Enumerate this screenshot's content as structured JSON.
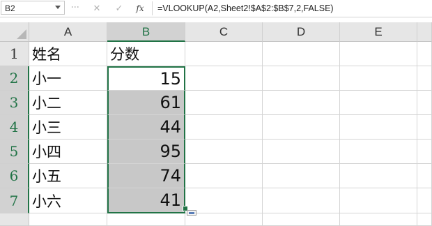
{
  "formula_bar": {
    "name_box": "B2",
    "cancel_icon": "✕",
    "enter_icon": "✓",
    "fx_label": "fx",
    "formula": "=VLOOKUP(A2,Sheet2!$A$2:$B$7,2,FALSE)"
  },
  "columns": [
    "A",
    "B",
    "C",
    "D",
    "E"
  ],
  "selected_column": "B",
  "rows": [
    {
      "num": "1",
      "a": "姓名",
      "b": "分数"
    },
    {
      "num": "2",
      "a": "小一",
      "b": "15"
    },
    {
      "num": "3",
      "a": "小二",
      "b": "61"
    },
    {
      "num": "4",
      "a": "小三",
      "b": "44"
    },
    {
      "num": "5",
      "a": "小四",
      "b": "95"
    },
    {
      "num": "6",
      "a": "小五",
      "b": "74"
    },
    {
      "num": "7",
      "a": "小六",
      "b": "41"
    }
  ],
  "selection_range": "B2:B7",
  "colors": {
    "selection_accent": "#217346",
    "selection_fill": "#c8c8c8"
  }
}
